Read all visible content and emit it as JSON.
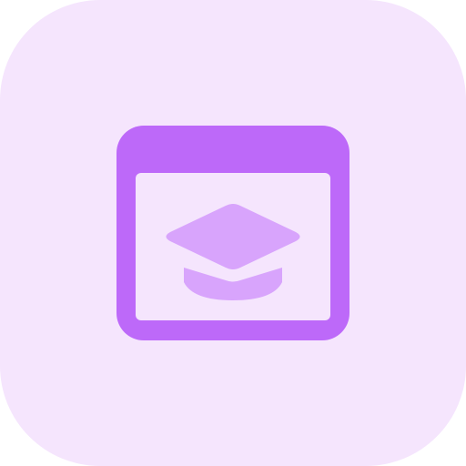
{
  "icon": {
    "name": "online-education-icon",
    "colors": {
      "background": "#f5e5fd",
      "primary": "#bd69f9",
      "secondary": "#d8a4fc",
      "window_inner": "#f5e5fd"
    }
  }
}
